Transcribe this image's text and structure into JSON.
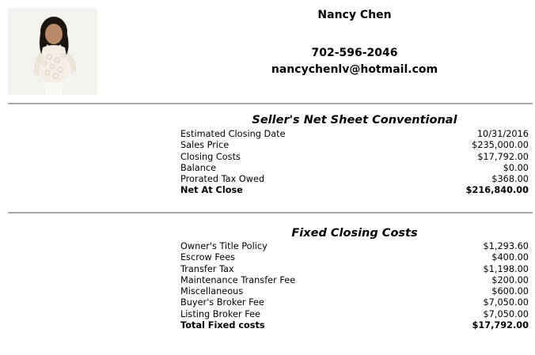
{
  "agent": {
    "name": "Nancy Chen",
    "phone": "702-596-2046",
    "email": "nancychenlv@hotmail.com"
  },
  "net_sheet": {
    "title": "Seller's Net Sheet Conventional",
    "rows": [
      {
        "label": "Estimated Closing Date",
        "value": "10/31/2016"
      },
      {
        "label": "Sales Price",
        "value": "$235,000.00"
      },
      {
        "label": "Closing Costs",
        "value": "$17,792.00"
      },
      {
        "label": "Balance",
        "value": "$0.00"
      },
      {
        "label": "Prorated Tax Owed",
        "value": "$368.00"
      },
      {
        "label": "Net At Close",
        "value": "$216,840.00"
      }
    ]
  },
  "fixed_costs": {
    "title": "Fixed Closing Costs",
    "rows": [
      {
        "label": "Owner's Title Policy",
        "value": "$1,293.60"
      },
      {
        "label": "Escrow Fees",
        "value": "$400.00"
      },
      {
        "label": "Transfer Tax",
        "value": "$1,198.00"
      },
      {
        "label": "Maintenance Transfer Fee",
        "value": "$200.00"
      },
      {
        "label": "Miscellaneous",
        "value": "$600.00"
      },
      {
        "label": "Buyer's Broker Fee",
        "value": "$7,050.00"
      },
      {
        "label": "Listing Broker Fee",
        "value": "$7,050.00"
      },
      {
        "label": "Total Fixed costs",
        "value": "$17,792.00"
      }
    ]
  }
}
